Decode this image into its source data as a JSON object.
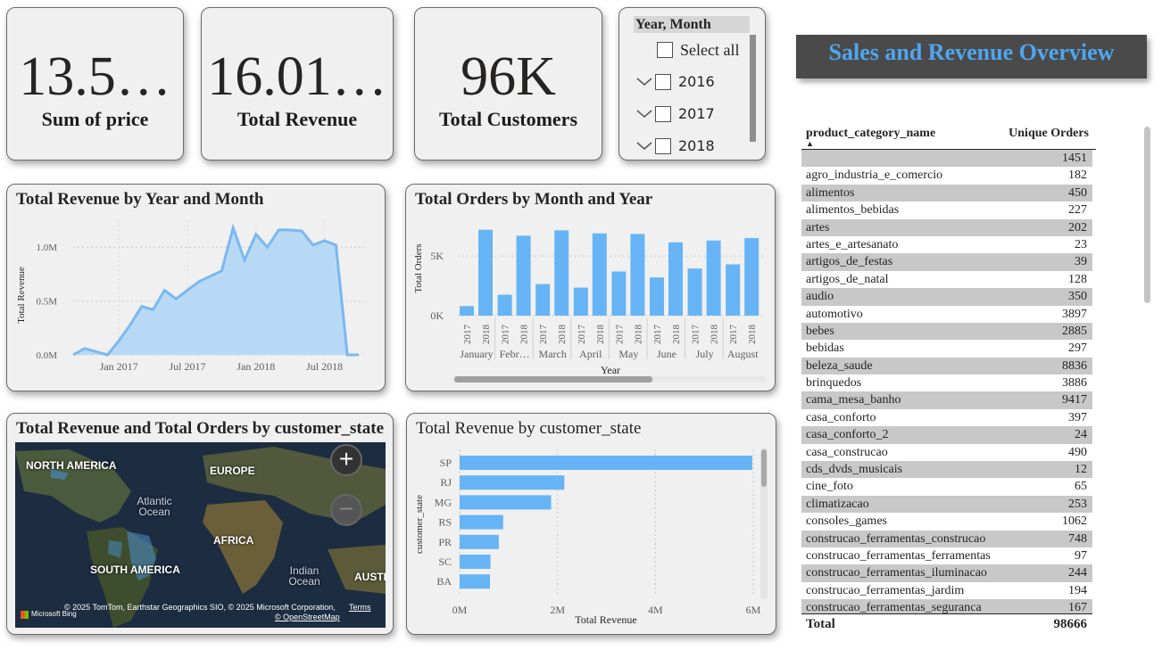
{
  "kpis": [
    {
      "value": "13.5…",
      "label": "Sum of price"
    },
    {
      "value": "16.01…",
      "label": "Total Revenue"
    },
    {
      "value": "96K",
      "label": "Total Customers"
    }
  ],
  "slicer": {
    "title": "Year, Month",
    "items": [
      {
        "label": "Select all",
        "expandable": false
      },
      {
        "label": "2016",
        "expandable": true
      },
      {
        "label": "2017",
        "expandable": true
      },
      {
        "label": "2018",
        "expandable": true
      }
    ]
  },
  "banner": {
    "title": "Sales and Revenue Overview"
  },
  "table": {
    "headers": [
      "product_category_name",
      "Unique Orders"
    ],
    "rows": [
      [
        "",
        "1451"
      ],
      [
        "agro_industria_e_comercio",
        "182"
      ],
      [
        "alimentos",
        "450"
      ],
      [
        "alimentos_bebidas",
        "227"
      ],
      [
        "artes",
        "202"
      ],
      [
        "artes_e_artesanato",
        "23"
      ],
      [
        "artigos_de_festas",
        "39"
      ],
      [
        "artigos_de_natal",
        "128"
      ],
      [
        "audio",
        "350"
      ],
      [
        "automotivo",
        "3897"
      ],
      [
        "bebes",
        "2885"
      ],
      [
        "bebidas",
        "297"
      ],
      [
        "beleza_saude",
        "8836"
      ],
      [
        "brinquedos",
        "3886"
      ],
      [
        "cama_mesa_banho",
        "9417"
      ],
      [
        "casa_conforto",
        "397"
      ],
      [
        "casa_conforto_2",
        "24"
      ],
      [
        "casa_construcao",
        "490"
      ],
      [
        "cds_dvds_musicais",
        "12"
      ],
      [
        "cine_foto",
        "65"
      ],
      [
        "climatizacao",
        "253"
      ],
      [
        "consoles_games",
        "1062"
      ],
      [
        "construcao_ferramentas_construcao",
        "748"
      ],
      [
        "construcao_ferramentas_ferramentas",
        "97"
      ],
      [
        "construcao_ferramentas_iluminacao",
        "244"
      ],
      [
        "construcao_ferramentas_jardim",
        "194"
      ],
      [
        "construcao_ferramentas_seguranca",
        "167"
      ]
    ],
    "total_label": "Total",
    "total_value": "98666"
  },
  "map": {
    "title": "Total Revenue and Total Orders by customer_state",
    "labels": {
      "north_america": "NORTH AMERICA",
      "europe": "EUROPE",
      "atlantic": "Atlantic Ocean",
      "africa": "AFRICA",
      "south_america": "SOUTH AMERICA",
      "indian": "Indian Ocean",
      "austr": "AUSTR"
    },
    "attribution": "© 2025 TomTom, Earthstar Geographics SIO, © 2025 Microsoft Corporation,",
    "terms": "Terms",
    "osm": "© OpenStreetMap",
    "bing": "Microsoft Bing",
    "zoom_in": "+",
    "zoom_out": "−"
  },
  "chart_data": [
    {
      "id": "revenue_line",
      "type": "area",
      "title": "Total Revenue by Year and Month",
      "ylabel": "Total Revenue",
      "xlabel": "",
      "y_ticks": [
        "0.0M",
        "0.5M",
        "1.0M"
      ],
      "x_ticks": [
        "Jan 2017",
        "Jul 2017",
        "Jan 2018",
        "Jul 2018"
      ],
      "ylim": [
        0,
        1.25
      ],
      "x": [
        "2016-09",
        "2016-10",
        "2016-12",
        "2017-01",
        "2017-02",
        "2017-03",
        "2017-04",
        "2017-05",
        "2017-06",
        "2017-07",
        "2017-08",
        "2017-09",
        "2017-10",
        "2017-11",
        "2017-12",
        "2018-01",
        "2018-02",
        "2018-03",
        "2018-04",
        "2018-05",
        "2018-06",
        "2018-07",
        "2018-08",
        "2018-09",
        "2018-10"
      ],
      "values": [
        0.0,
        0.06,
        0.0,
        0.13,
        0.28,
        0.45,
        0.42,
        0.6,
        0.52,
        0.6,
        0.68,
        0.73,
        0.78,
        1.18,
        0.88,
        1.12,
        1.0,
        1.16,
        1.16,
        1.15,
        1.02,
        1.06,
        1.02,
        0.0,
        0.0
      ],
      "color": "#7ab8f0",
      "fill": "#b8d9f6",
      "grid": true
    },
    {
      "id": "orders_bar",
      "type": "bar",
      "title": "Total Orders by Month and Year",
      "ylabel": "Total Orders",
      "xlabel": "Year",
      "y_ticks": [
        "0K",
        "5K"
      ],
      "ylim": [
        0,
        8000
      ],
      "months": [
        "January",
        "Febr…",
        "March",
        "April",
        "May",
        "June",
        "July",
        "August"
      ],
      "years": [
        "2017",
        "2018"
      ],
      "values": [
        [
          800,
          7200
        ],
        [
          1750,
          6700
        ],
        [
          2650,
          7150
        ],
        [
          2350,
          6900
        ],
        [
          3700,
          6850
        ],
        [
          3200,
          6150
        ],
        [
          3950,
          6300
        ],
        [
          4300,
          6500
        ]
      ],
      "color": "#66b4f5"
    },
    {
      "id": "state_bar",
      "type": "bar",
      "title": "Total Revenue by customer_state",
      "ylabel": "customer_state",
      "xlabel": "Total Revenue",
      "x_ticks": [
        "0M",
        "2M",
        "4M",
        "6M"
      ],
      "xlim": [
        0,
        6
      ],
      "categories": [
        "SP",
        "RJ",
        "MG",
        "RS",
        "PR",
        "SC",
        "BA"
      ],
      "values": [
        5.98,
        2.14,
        1.87,
        0.89,
        0.8,
        0.63,
        0.62
      ],
      "color": "#66b4f5"
    }
  ]
}
